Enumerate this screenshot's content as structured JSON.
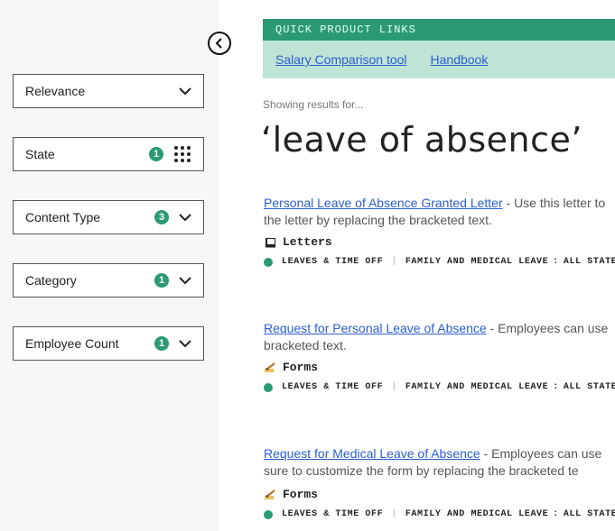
{
  "sidebar": {
    "filters": [
      {
        "label": "Relevance",
        "count": "",
        "control": "chevron-down"
      },
      {
        "label": "State",
        "count": "1",
        "control": "grid"
      },
      {
        "label": "Content Type",
        "count": "3",
        "control": "chevron-down"
      },
      {
        "label": "Category",
        "count": "1",
        "control": "chevron-down"
      },
      {
        "label": "Employee Count",
        "count": "1",
        "control": "chevron-down"
      }
    ]
  },
  "quick_links": {
    "header": "QUICK PRODUCT LINKS",
    "links": [
      "Salary Comparison tool",
      "Handbook"
    ]
  },
  "search": {
    "showing_label": "Showing results for...",
    "query": "‘leave of absence’"
  },
  "results": [
    {
      "title": "Personal Leave of Absence Granted Letter",
      "desc_line1": " - Use this letter to",
      "desc_line2": "the letter by replacing the bracketed text.",
      "type": "Letters",
      "type_icon": "book-icon",
      "tag1": "LEAVES & TIME OFF",
      "tag2": "FAMILY AND MEDICAL LEAVE",
      "tag3": "ALL STATES"
    },
    {
      "title": "Request for Personal Leave of Absence",
      "desc_line1": " - Employees can use",
      "desc_line2": "bracketed text.",
      "type": "Forms",
      "type_icon": "form-pencil-icon",
      "tag1": "LEAVES & TIME OFF",
      "tag2": "FAMILY AND MEDICAL LEAVE",
      "tag3": "ALL STATES"
    },
    {
      "title": "Request for Medical Leave of Absence",
      "desc_line1": " - Employees can use",
      "desc_line2": "sure to customize the form by replacing the bracketed te",
      "type": "Forms",
      "type_icon": "form-pencil-icon",
      "tag1": "LEAVES & TIME OFF",
      "tag2": "FAMILY AND MEDICAL LEAVE",
      "tag3": "ALL STATES"
    }
  ],
  "colors": {
    "accent": "#2a9a74",
    "link": "#2a5ed0",
    "quick_links_bg": "#bfe4d6"
  }
}
